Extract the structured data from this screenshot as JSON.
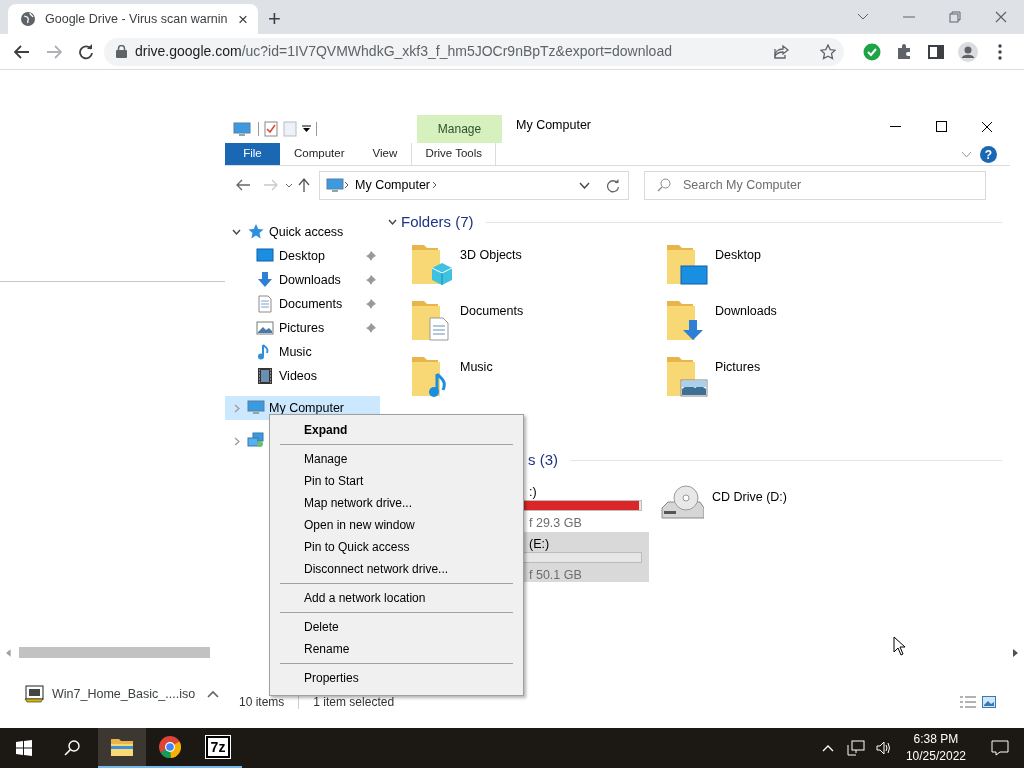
{
  "browser": {
    "tabs": [
      {
        "title": "Google Drive - Virus scan warnin",
        "close": "×",
        "selected": true
      }
    ],
    "new_tab": "+",
    "url": {
      "host": "drive.google.com",
      "path": "/uc?id=1IV7QVMWhdkG_xkf3_f_hm5JOCr9nBpTz&export=download"
    }
  },
  "download": {
    "filename": "Win7_Home_Basic_....iso"
  },
  "explorer": {
    "title": "My Computer",
    "contextual_group": "Manage",
    "ribbon_tabs": [
      {
        "label": "File",
        "kind": "file"
      },
      {
        "label": "Computer",
        "kind": "tab"
      },
      {
        "label": "View",
        "kind": "tab"
      },
      {
        "label": "Drive Tools",
        "kind": "contextual"
      }
    ],
    "help": "?",
    "address": "My Computer",
    "search": {
      "placeholder": "Search My Computer"
    },
    "nav": [
      {
        "label": "Quick access",
        "kind": "quick",
        "expanded": true,
        "selected": false,
        "children": [
          {
            "label": "Desktop",
            "kind": "desktop",
            "pinned": true,
            "selected": false
          },
          {
            "label": "Downloads",
            "kind": "downloads",
            "pinned": true,
            "selected": false
          },
          {
            "label": "Documents",
            "kind": "documents",
            "pinned": true,
            "selected": false
          },
          {
            "label": "Pictures",
            "kind": "pictures",
            "pinned": true,
            "selected": false
          },
          {
            "label": "Music",
            "kind": "music",
            "pinned": false,
            "selected": false
          },
          {
            "label": "Videos",
            "kind": "videos",
            "pinned": false,
            "selected": false
          }
        ]
      },
      {
        "label": "My Computer",
        "kind": "computer",
        "expanded": false,
        "selected": true
      },
      {
        "kind": "network",
        "expanded": false,
        "selected": false
      }
    ],
    "folders": {
      "header": "Folders (7)",
      "expanded": true,
      "items": [
        {
          "label": "3D Objects",
          "kind": "objects"
        },
        {
          "label": "Desktop",
          "kind": "desktop"
        },
        {
          "label": "Documents",
          "kind": "documents"
        },
        {
          "label": "Downloads",
          "kind": "downloads"
        },
        {
          "label": "Music",
          "kind": "music"
        },
        {
          "label": "Pictures",
          "kind": "pictures"
        }
      ]
    },
    "devices": {
      "header": "s (3)",
      "items": [
        {
          "label": ":)",
          "kind": "disk",
          "level": 0.99,
          "detail": "f 29.3 GB",
          "selected": false
        },
        {
          "label": "CD Drive (D:)",
          "kind": "cd",
          "selected": false
        },
        {
          "label": "(E:)",
          "kind": "disk",
          "level": 0.0,
          "detail": "f 50.1 GB",
          "selected": true
        }
      ]
    },
    "status": {
      "count": "10 items",
      "selection": "1 item selected"
    },
    "context_menu": [
      {
        "kind": "item",
        "label": "Expand",
        "default": true
      },
      {
        "kind": "separator"
      },
      {
        "kind": "item",
        "label": "Manage",
        "default": false
      },
      {
        "kind": "item",
        "label": "Pin to Start",
        "default": false
      },
      {
        "kind": "item",
        "label": "Map network drive...",
        "default": false
      },
      {
        "kind": "item",
        "label": "Open in new window",
        "default": false
      },
      {
        "kind": "item",
        "label": "Pin to Quick access",
        "default": false
      },
      {
        "kind": "item",
        "label": "Disconnect network drive...",
        "default": false
      },
      {
        "kind": "separator"
      },
      {
        "kind": "item",
        "label": "Add a network location",
        "default": false
      },
      {
        "kind": "separator"
      },
      {
        "kind": "item",
        "label": "Delete",
        "default": false
      },
      {
        "kind": "item",
        "label": "Rename",
        "default": false
      },
      {
        "kind": "separator"
      },
      {
        "kind": "item",
        "label": "Properties",
        "default": false
      }
    ]
  },
  "taskbar": {
    "apps": [
      {
        "kind": "explorer",
        "selected": true,
        "running": true
      },
      {
        "kind": "browser",
        "selected": false,
        "running": true
      },
      {
        "kind": "archiver",
        "label": "7z",
        "selected": false,
        "running": true
      }
    ],
    "time": "6:38 PM",
    "date": "10/25/2022"
  }
}
